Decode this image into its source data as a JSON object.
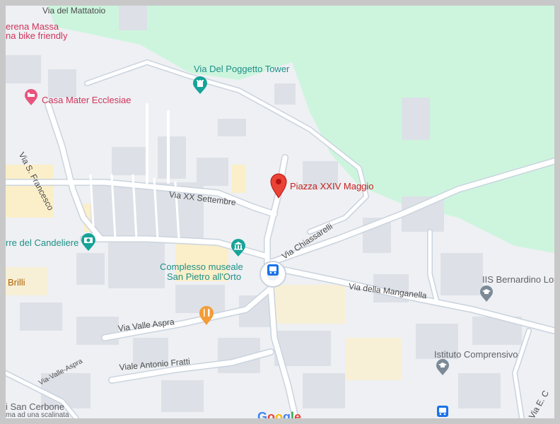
{
  "map": {
    "pin": {
      "label": "Piazza XXIV Maggio"
    },
    "pois": {
      "serena_massa": "erena Massa",
      "bike_friendly": "na bike friendly",
      "poggetto": "Via Del Poggetto Tower",
      "casa_mater": "Casa Mater Ecclesiae",
      "candeliere": "rre del Candeliere",
      "museo_line1": "Complesso museale",
      "museo_line2": "San Pietro all'Orto",
      "brilli": "Brilli",
      "iis": "IIS Bernardino Lo",
      "istituto": "Istituto Comprensivo",
      "san_cerbone": "i San Cerbone",
      "scalinata": "ma ad una scalinata"
    },
    "streets": {
      "mattatoio": "Via del Mattatoio",
      "san_francesco": "Via S. Francesco",
      "xx_settembre": "Via XX Settembre",
      "chiassarelli": "Via Chiassarelli",
      "manganella": "Via della Manganella",
      "valle_aspra": "Via Valle Aspra",
      "valle_aspra_small": "Via-Valle-Aspra",
      "antonio_fratti": "Viale Antonio Fratti",
      "via_e": "Via E. C"
    },
    "attribution": {
      "google": "Google"
    },
    "colors": {
      "park": "#cdf5de",
      "road": "#ffffff",
      "road_casing": "#c9d3de",
      "building": "#dde1e7",
      "highlight_area": "#fbefc9",
      "pin": "#ea4335",
      "teal_icon": "#17a398",
      "pink_icon": "#e8547c",
      "orange_icon": "#f29d38",
      "gray_icon": "#7c8a98",
      "bus_icon": "#1a73e8"
    },
    "icons": [
      "map-pin-icon",
      "tower-icon",
      "hotel-bed-icon",
      "camera-icon",
      "museum-icon",
      "restaurant-icon",
      "school-icon",
      "bus-stop-icon"
    ]
  }
}
